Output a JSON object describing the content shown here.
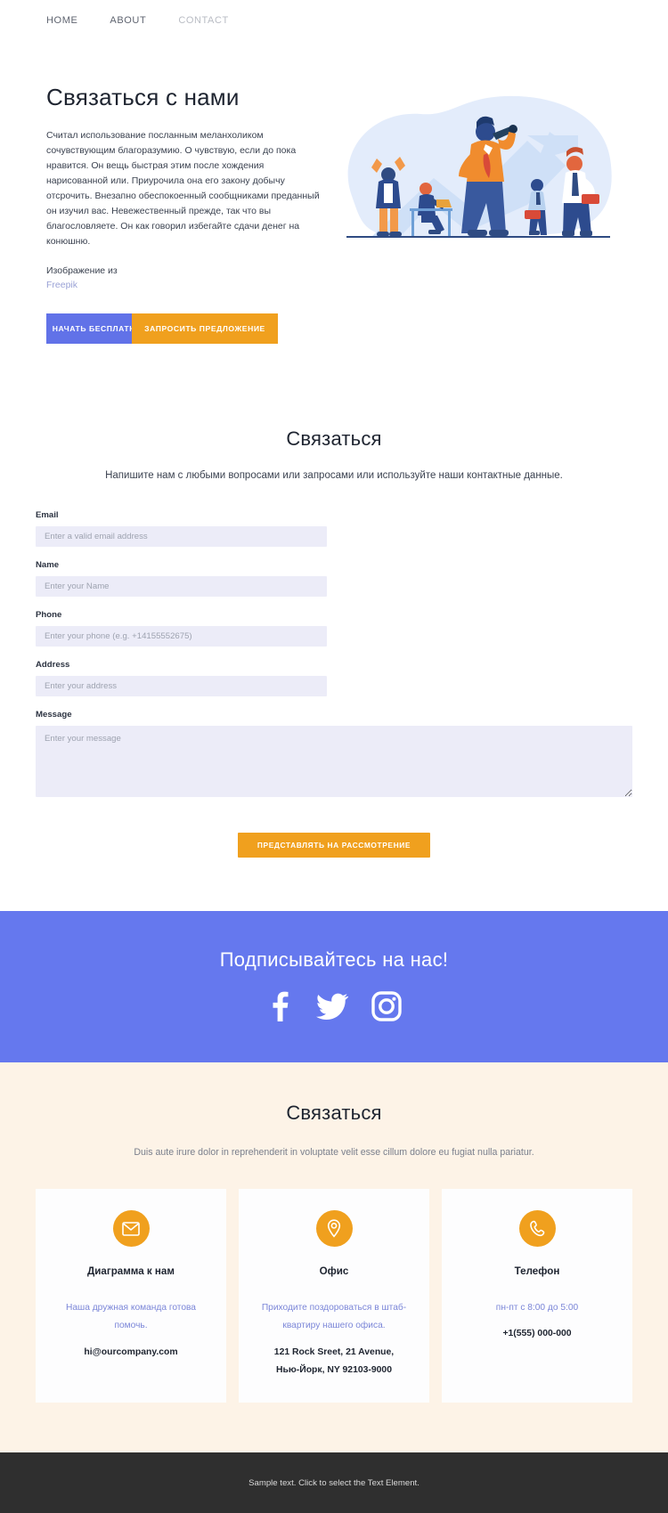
{
  "nav": {
    "items": [
      {
        "label": "HOME",
        "active": false
      },
      {
        "label": "ABOUT",
        "active": false
      },
      {
        "label": "CONTACT",
        "active": true
      }
    ]
  },
  "hero": {
    "title": "Связаться с нами",
    "body": "Считал использование посланным меланхоликом сочувствующим благоразумию. О чувствую, если до пока нравится. Он вещь быстрая этим после хождения нарисованной или. Приурочила она его закону добычу отсрочить. Внезапно обеспокоенный сообщниками преданный он изучил вас. Невежественный прежде, так что вы благословляете. Он как говорил избегайте сдачи денег на конюшню.",
    "credit_label": "Изображение из",
    "credit_link": "Freepik",
    "primary_button": "НАЧАТЬ БЕСПЛАТНО",
    "secondary_button": "ЗАПРОСИТЬ ПРЕДЛОЖЕНИЕ",
    "illustration_name": "business-team-telescope-growth-illustration"
  },
  "form": {
    "title": "Связаться",
    "subtitle": "Напишите нам с любыми вопросами или запросами или используйте наши контактные данные.",
    "fields": [
      {
        "label": "Email",
        "placeholder": "Enter a valid email address",
        "value": ""
      },
      {
        "label": "Name",
        "placeholder": "Enter your Name",
        "value": ""
      },
      {
        "label": "Phone",
        "placeholder": "Enter your phone (e.g. +14155552675)",
        "value": ""
      },
      {
        "label": "Address",
        "placeholder": "Enter your address",
        "value": ""
      },
      {
        "label": "Message",
        "placeholder": "Enter your message",
        "value": ""
      }
    ],
    "submit_label": "ПРЕДСТАВЛЯТЬ НА РАССМОТРЕНИЕ"
  },
  "social": {
    "title": "Подписывайтесь на нас!",
    "icons": [
      {
        "name": "facebook-icon"
      },
      {
        "name": "twitter-icon"
      },
      {
        "name": "instagram-icon"
      }
    ]
  },
  "contact": {
    "title": "Связаться",
    "subtitle": "Duis aute irure dolor in reprehenderit in voluptate velit esse cillum dolore eu fugiat nulla pariatur.",
    "cards": [
      {
        "icon": "envelope-icon",
        "title": "Диаграмма к нам",
        "note": "Наша дружная команда готова помочь.",
        "value": "hi@ourcompany.com",
        "value2": ""
      },
      {
        "icon": "map-pin-icon",
        "title": "Офис",
        "note": "Приходите поздороваться в штаб-квартиру нашего офиса.",
        "value": "121 Rock Sreet, 21 Avenue,",
        "value2": "Нью-Йорк, NY 92103-9000"
      },
      {
        "icon": "phone-icon",
        "title": "Телефон",
        "note": "пн-пт с 8:00 до 5:00",
        "value": "+1(555) 000-000",
        "value2": ""
      }
    ]
  },
  "footer": {
    "text": "Sample text. Click to select the Text Element."
  },
  "colors": {
    "accent_blue": "#6172e8",
    "accent_orange": "#f0a01e",
    "social_bg": "#6578ee",
    "beige_bg": "#fdf3e7",
    "input_bg": "#ececf8",
    "footer_bg": "#2f2f2f",
    "link_purple": "#7b86d8"
  }
}
